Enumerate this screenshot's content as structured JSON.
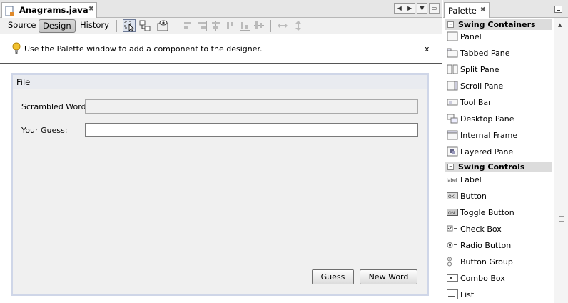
{
  "editor": {
    "tab_title": "Anagrams.java",
    "views": [
      "Source",
      "Design",
      "History"
    ],
    "active_view": "Design",
    "hint_text": "Use the Palette window to add a component to the designer.",
    "hint_close": "x"
  },
  "form": {
    "menu": "File",
    "scrambled_label": "Scrambled Word:",
    "scrambled_value": "",
    "guess_label": "Your Guess:",
    "guess_value": "",
    "guess_button": "Guess",
    "newword_button": "New Word"
  },
  "palette": {
    "title": "Palette",
    "categories": [
      {
        "name": "Swing Containers",
        "items": [
          "Panel",
          "Tabbed Pane",
          "Split Pane",
          "Scroll Pane",
          "Tool Bar",
          "Desktop Pane",
          "Internal Frame",
          "Layered Pane"
        ]
      },
      {
        "name": "Swing Controls",
        "items": [
          "Label",
          "Button",
          "Toggle Button",
          "Check Box",
          "Radio Button",
          "Button Group",
          "Combo Box",
          "List"
        ]
      }
    ]
  },
  "colors": {
    "form_border": "#cfd6e8",
    "hint_bulb": "#f2c230"
  }
}
